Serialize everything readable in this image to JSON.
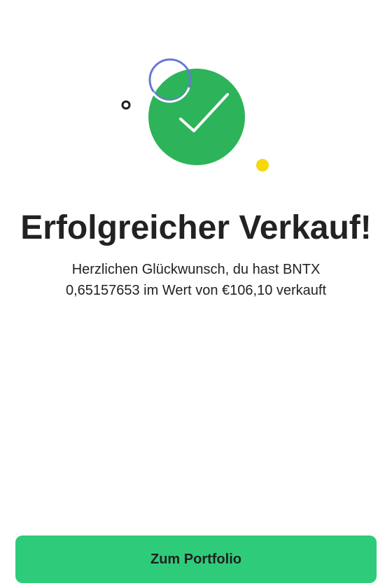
{
  "success": {
    "title": "Erfolgreicher Verkauf!",
    "message_line1": "Herzlichen Glückwunsch, du hast BNTX",
    "message_line2": "0,65157653 im Wert von €106,10 verkauft",
    "icon": "check-icon"
  },
  "actions": {
    "portfolio_label": "Zum Portfolio"
  },
  "colors": {
    "success_green": "#2db35a",
    "button_green": "#2ecc7a",
    "ring_blue": "#6b78d6",
    "dot_yellow": "#f5d90a",
    "text_dark": "#222222"
  }
}
